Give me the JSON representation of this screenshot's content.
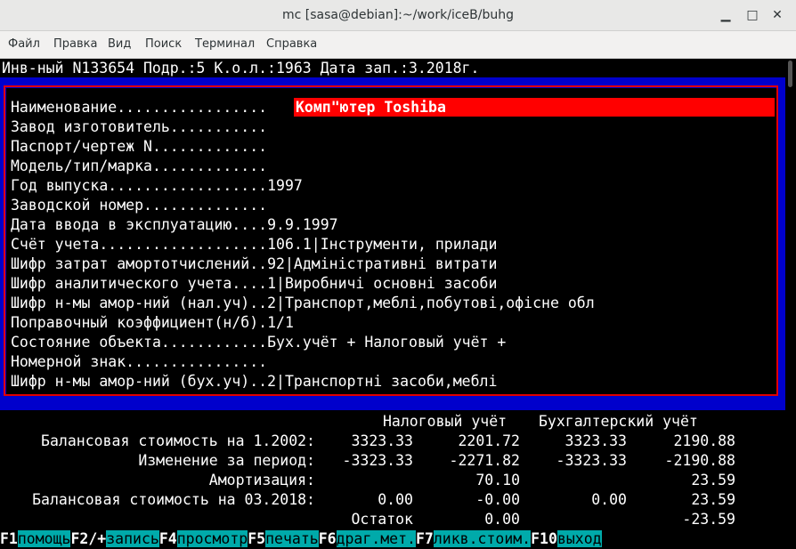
{
  "window": {
    "title": "mc [sasa@debian]:~/work/iceB/buhg"
  },
  "menu": [
    "Файл",
    "Правка",
    "Вид",
    "Поиск",
    "Терминал",
    "Справка"
  ],
  "header_line": "Инв-ный N133654 Подр.:5 К.о.л.:1963 Дата зап.:3.2018г.",
  "fields": [
    {
      "label": "Наименование.................",
      "value": "Комп\"ютер Toshiba"
    },
    {
      "label": "Завод изготовитель...........",
      "value": ""
    },
    {
      "label": "Паспорт/чертеж N.............",
      "value": ""
    },
    {
      "label": "Модель/тип/марка.............",
      "value": ""
    },
    {
      "label": "Год выпуска..................",
      "value": "1997"
    },
    {
      "label": "Заводской номер..............",
      "value": ""
    },
    {
      "label": "Дата ввода в эксплуатацию....",
      "value": "9.9.1997"
    },
    {
      "label": "Счёт учета...................",
      "value": "106.1|Інструменти, прилади"
    },
    {
      "label": "Шифр затрат амортотчислений..",
      "value": "92|Адміністративні витрати"
    },
    {
      "label": "Шифр аналитического учета....",
      "value": "1|Виробничі основні засоби"
    },
    {
      "label": "Шифр н-мы амор-ний (нал.уч)..",
      "value": "2|Транспорт,меблі,побутові,офісне обл"
    },
    {
      "label": "Поправочный коэффициент(н/б).",
      "value": "1/1"
    },
    {
      "label": "Состояние объекта............",
      "value": "Бух.учёт + Налоговый учёт +"
    },
    {
      "label": "Номерной знак................",
      "value": ""
    },
    {
      "label": "Шифр н-мы амор-ний (бух.уч)..",
      "value": "2|Транспортні засоби,меблі"
    }
  ],
  "table": {
    "col_headers": [
      "Налоговый учёт",
      "Бухгалтерский учёт"
    ],
    "rows": [
      {
        "label": "Балансовая стоимость на 1.2002:",
        "values": [
          "3323.33",
          "2201.72",
          "3323.33",
          "2190.88"
        ]
      },
      {
        "label": "Изменение за период:",
        "values": [
          "-3323.33",
          "-2271.82",
          "-3323.33",
          "-2190.88"
        ]
      },
      {
        "label": "Амортизация:",
        "values": [
          "",
          "70.10",
          "",
          "23.59"
        ]
      },
      {
        "label": "Балансовая стоимость на 03.2018:",
        "values": [
          "0.00",
          "-0.00",
          "0.00",
          "23.59"
        ]
      },
      {
        "label": "Остаток",
        "values": [
          "",
          "0.00",
          "",
          "-23.59"
        ]
      }
    ]
  },
  "fkeys": [
    {
      "key": "F1",
      "label": "помощь"
    },
    {
      "key": "F2/+",
      "label": "запись"
    },
    {
      "key": "F4",
      "label": "просмотр"
    },
    {
      "key": "F5",
      "label": "печать"
    },
    {
      "key": "F6",
      "label": "драг.мет."
    },
    {
      "key": "F7",
      "label": "ликв.стоим."
    },
    {
      "key": "F10",
      "label": "выход"
    }
  ],
  "colors": {
    "accent_blue": "#0000cc",
    "highlight_red": "#ff0000",
    "fkey_bg": "#00aaaa"
  }
}
